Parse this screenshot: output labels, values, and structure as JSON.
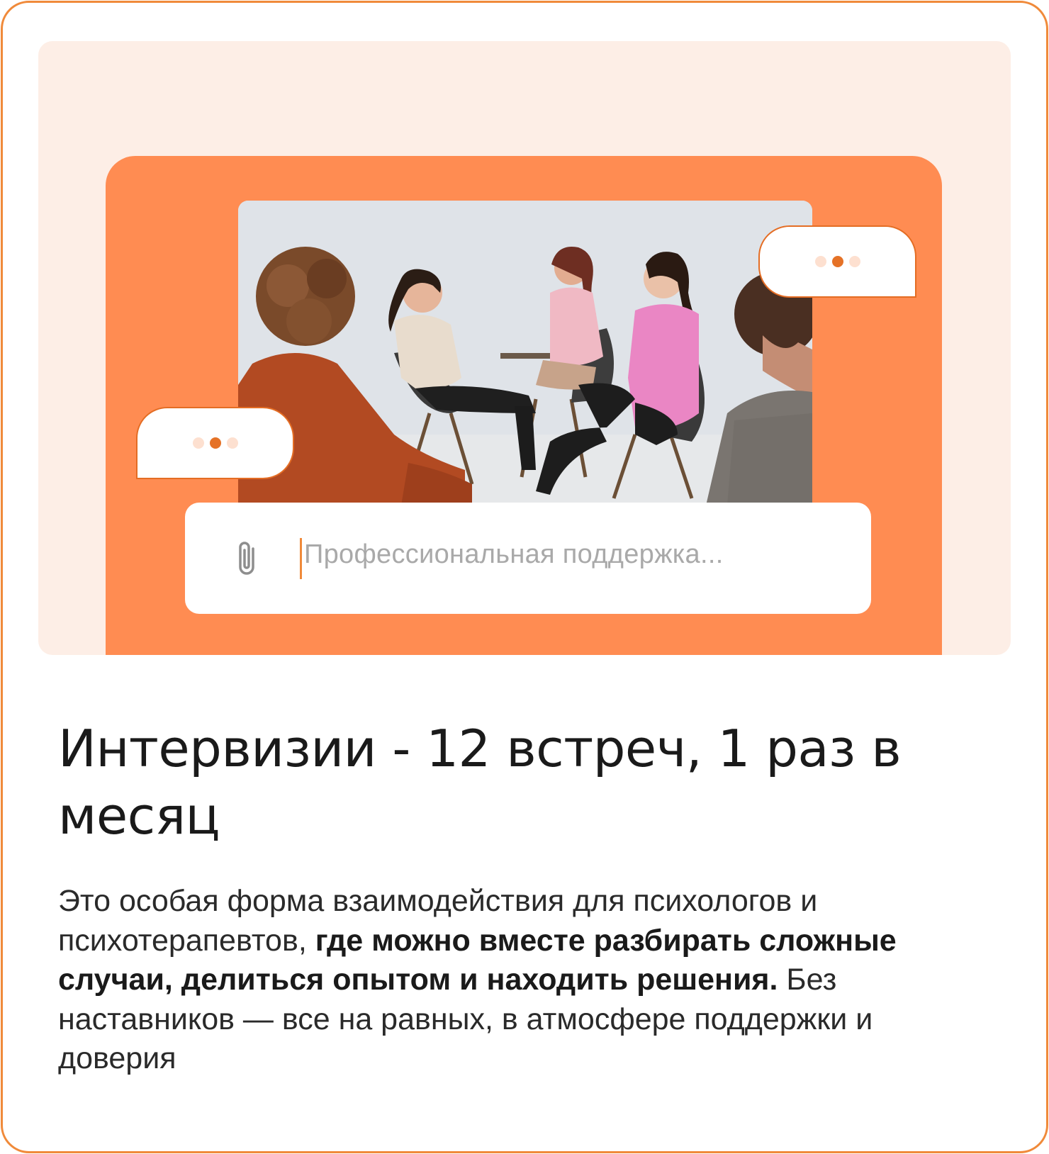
{
  "hero": {
    "photo_alt": "group-of-women-sitting-in-circle-photo",
    "input": {
      "placeholder": "Профессиональная поддержка...",
      "attach_icon": "paperclip-icon"
    },
    "bubble_right": {
      "icon": "typing-dots-icon"
    },
    "bubble_left": {
      "icon": "typing-dots-icon"
    }
  },
  "title": "Интервизии - 12 встреч, 1 раз в месяц",
  "description": {
    "part1": "Это особая форма взаимодействия для психологов и психотерапевтов, ",
    "bold": "где можно вместе разбирать сложные случаи, делиться опытом и находить решения.",
    "part2": " Без наставников — все на равных, в атмосфере поддержки и доверия"
  },
  "colors": {
    "accent": "#f08a3a",
    "panel": "#ff8c52",
    "hero_bg": "#fdeee6"
  }
}
